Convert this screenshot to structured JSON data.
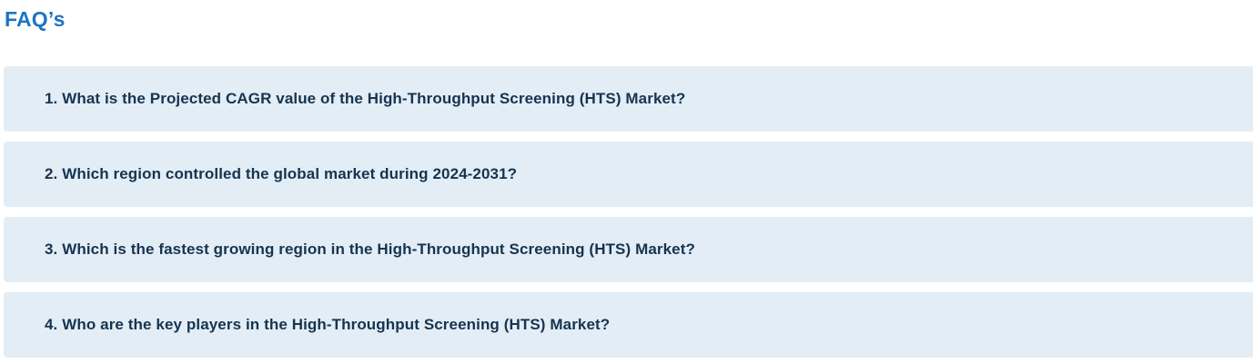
{
  "header": {
    "title": "FAQ’s"
  },
  "faq": {
    "items": [
      {
        "question": "1. What is the Projected CAGR value of the High-Throughput Screening (HTS) Market?"
      },
      {
        "question": "2. Which region controlled the global market during 2024-2031?"
      },
      {
        "question": "3. Which is the fastest growing region in the High-Throughput Screening (HTS) Market?"
      },
      {
        "question": "4. Who are the key players in the High-Throughput Screening (HTS) Market?"
      }
    ]
  },
  "colors": {
    "title": "#1f74c4",
    "item_background": "#e3edf6",
    "question_text": "#16344f"
  }
}
